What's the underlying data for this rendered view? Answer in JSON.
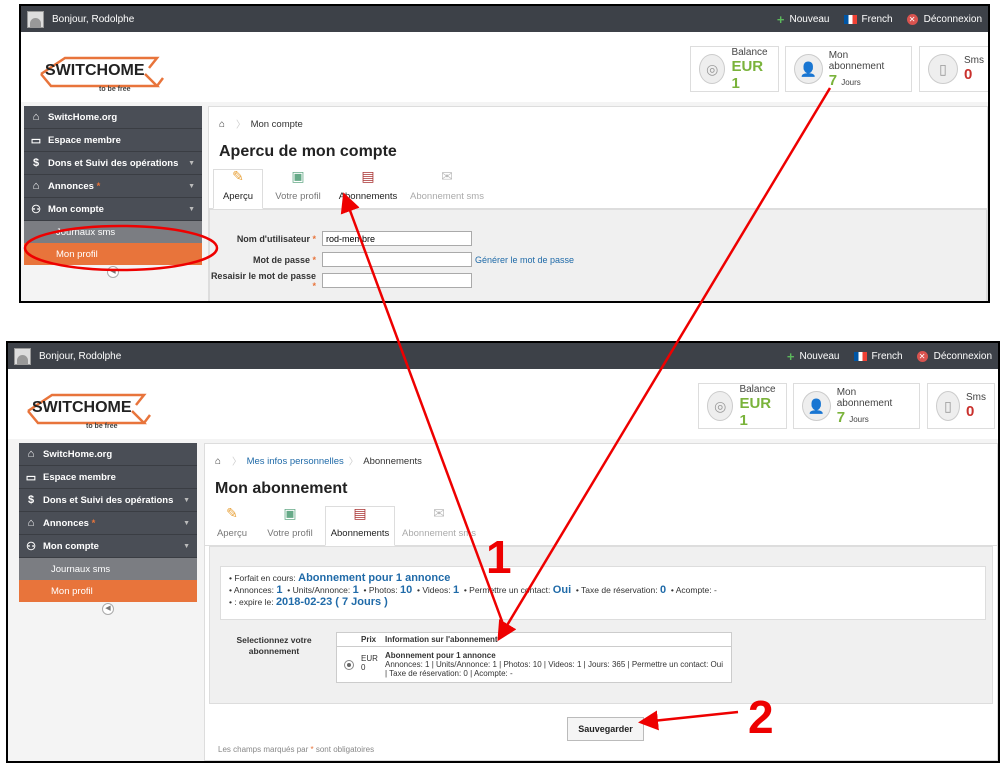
{
  "top_panel": {
    "topbar": {
      "greeting": "Bonjour, Rodolphe",
      "new_label": "Nouveau",
      "lang_label": "French",
      "logout_label": "Déconnexion"
    },
    "logo": {
      "word": "SWITCHOME",
      "tagline": "to be free"
    },
    "stats": {
      "balance_label": "Balance",
      "balance_value": "EUR 1",
      "sub_label": "Mon abonnement",
      "sub_value": "7",
      "sub_unit": "Jours",
      "sms_label": "Sms",
      "sms_value": "0"
    },
    "sidebar": {
      "items": [
        {
          "label": "SwitcHome.org"
        },
        {
          "label": "Espace membre"
        },
        {
          "label": "Dons et Suivi des opérations"
        },
        {
          "label": "Annonces",
          "mark": "*"
        },
        {
          "label": "Mon compte"
        }
      ],
      "subitems": [
        {
          "label": "Journaux sms"
        },
        {
          "label": "Mon profil"
        }
      ]
    },
    "breadcrumb": {
      "current": "Mon compte"
    },
    "page_title": "Apercu de mon compte",
    "tabs": [
      {
        "label": "Aperçu"
      },
      {
        "label": "Votre profil"
      },
      {
        "label": "Abonnements"
      },
      {
        "label": "Abonnement sms"
      }
    ],
    "form": {
      "username_label": "Nom d'utilisateur",
      "username_value": "rod-membre",
      "password_label": "Mot de passe",
      "generate_link": "Générer le mot de passe",
      "password2_label": "Resaisir le mot de passe"
    }
  },
  "bottom_panel": {
    "topbar": {
      "greeting": "Bonjour, Rodolphe",
      "new_label": "Nouveau",
      "lang_label": "French",
      "logout_label": "Déconnexion"
    },
    "logo": {
      "word": "SWITCHOME",
      "tagline": "to be free"
    },
    "stats": {
      "balance_label": "Balance",
      "balance_value": "EUR 1",
      "sub_label": "Mon abonnement",
      "sub_value": "7",
      "sub_unit": "Jours",
      "sms_label": "Sms",
      "sms_value": "0"
    },
    "sidebar": {
      "items": [
        {
          "label": "SwitcHome.org"
        },
        {
          "label": "Espace membre"
        },
        {
          "label": "Dons et Suivi des opérations"
        },
        {
          "label": "Annonces",
          "mark": "*"
        },
        {
          "label": "Mon compte"
        }
      ],
      "subitems": [
        {
          "label": "Journaux sms"
        },
        {
          "label": "Mon profil"
        }
      ]
    },
    "breadcrumb": {
      "parent": "Mes infos personnelles",
      "current": "Abonnements"
    },
    "page_title": "Mon abonnement",
    "tabs": [
      {
        "label": "Aperçu"
      },
      {
        "label": "Votre profil"
      },
      {
        "label": "Abonnements"
      },
      {
        "label": "Abonnement sms"
      }
    ],
    "info": {
      "plan_label": "• Forfait en cours:",
      "plan_value": "Abonnement pour 1 annonce",
      "annonces_label": "• Annonces:",
      "annonces_value": "1",
      "units_label": "• Units/Annonce:",
      "units_value": "1",
      "photos_label": "• Photos:",
      "photos_value": "10",
      "videos_label": "• Videos:",
      "videos_value": "1",
      "contact_label": "• Permettre un contact:",
      "contact_value": "Oui",
      "tax_label": "• Taxe de réservation:",
      "tax_value": "0",
      "deposit_label": "• Acompte:",
      "deposit_value": "-",
      "expire_label": "• : expire le:",
      "expire_value": "2018-02-23 ( 7 Jours )"
    },
    "select_label": "Selectionnez votre abonnement",
    "table": {
      "headers": [
        "Prix",
        "Information sur l'abonnement"
      ],
      "row": {
        "currency": "EUR",
        "price": "0",
        "title": "Abonnement pour 1 annonce",
        "details": "Annonces: 1 | Units/Annonce: 1 | Photos: 10 | Videos: 1 | Jours: 365 | Permettre un contact: Oui | Taxe de réservation: 0 | Acompte: -"
      }
    },
    "save_label": "Sauvegarder",
    "footnote_before": "Les champs marqués par",
    "footnote_mark": "*",
    "footnote_after": "sont obligatoires"
  },
  "annotations": {
    "step1": "1",
    "step2": "2",
    "arrow_color": "#e00000"
  }
}
